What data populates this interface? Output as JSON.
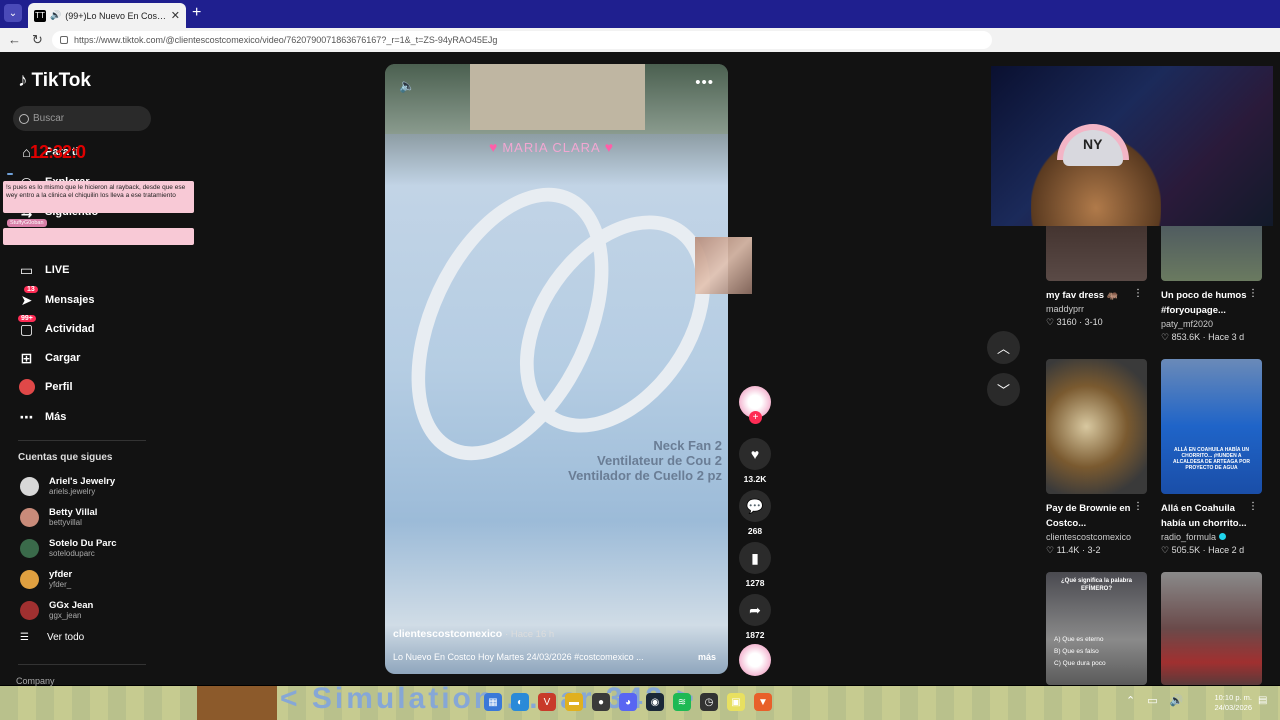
{
  "browser": {
    "tab_title": "(99+)Lo Nuevo En Costco Hoy Martes",
    "tab_favicon": "TT",
    "new_tab": "+",
    "url": "https://www.tiktok.com/@clientescostcomexico/video/7620790071863676167?_r=1&_t=ZS-94yRAO45EJg"
  },
  "sidebar": {
    "logo": "TikTok",
    "search_placeholder": "Buscar",
    "timer_text": "12:32:0",
    "menu": [
      {
        "label": "Para ti",
        "icon": "home-icon"
      },
      {
        "label": "Explorar",
        "icon": "compass-icon"
      },
      {
        "label": "Siguiendo",
        "icon": "following-icon"
      },
      {
        "label": "LIVE",
        "icon": "live-icon"
      },
      {
        "label": "Mensajes",
        "icon": "messages-icon",
        "badge": "13"
      },
      {
        "label": "Actividad",
        "icon": "activity-icon",
        "badge": "99+"
      },
      {
        "label": "Cargar",
        "icon": "upload-icon"
      },
      {
        "label": "Perfil",
        "icon": "profile-icon"
      },
      {
        "label": "Más",
        "icon": "more-icon"
      }
    ],
    "following_title": "Cuentas que sigues",
    "accounts": [
      {
        "name": "Ariel's Jewelry",
        "handle": "ariels.jewelry",
        "color": "#d8d8d8"
      },
      {
        "name": "Betty Villal",
        "handle": "bettyvillal",
        "color": "#c98b7a"
      },
      {
        "name": "Sotelo Du Parc",
        "handle": "soteloduparc",
        "color": "#3a6a4a"
      },
      {
        "name": "yfder",
        "handle": "yfder_",
        "color": "#e0a040"
      },
      {
        "name": "GGx Jean",
        "handle": "ggx_jean",
        "color": "#a03030"
      }
    ],
    "see_all": "Ver todo",
    "company": "Company"
  },
  "chat": {
    "user1": "",
    "message1": "!s pues es lo mismo que le hicieron al rayback, desde que ese wey entro a la clinica el chiquilin los lleva a ese tratamiento",
    "user2": "StuffyG0oban"
  },
  "video": {
    "overlay_title": "MARIA CLARA",
    "product_text": [
      "Neck Fan 2",
      "Ventilateur de Cou 2",
      "Ventilador de Cuello 2 pz"
    ],
    "author": "clientescostcomexico",
    "posted": "· Hace 16 h",
    "description": "Lo Nuevo En Costco Hoy Martes 24/03/2026 #costcomexico ...",
    "more": "más"
  },
  "actions": {
    "likes": "13.2K",
    "comments": "268",
    "saves": "1278",
    "shares": "1872"
  },
  "recommendations": [
    {
      "title": "my fav dress 🦛",
      "user": "maddyprr",
      "likes": "3160",
      "date": "3-10",
      "thumb": "#4a3a36"
    },
    {
      "title": "Un poco de humos #foryoupage...",
      "user": "paty_mf2020",
      "likes": "853.6K",
      "date": "Hace 3 d",
      "thumb": "#5a6470"
    },
    {
      "title": "Pay de Brownie en Costco...",
      "user": "clientescostcomexico",
      "likes": "11.4K",
      "date": "3-2",
      "thumb": "#6a5030"
    },
    {
      "title": "Allá en Coahuila había un chorrito...",
      "user": "radio_formula",
      "likes": "505.5K",
      "date": "Hace 2 d",
      "thumb": "#1f64c8",
      "verified": true,
      "thumb_text": "ALLÁ EN COAHUILA HABÍA UN CHORRITO... ¡HUNDEN A ALCALDESA DE ARTEAGA POR PROYECTO DE AGUA"
    },
    {
      "title": "",
      "user": "",
      "likes": "",
      "date": "",
      "thumb": "#6a6a6a",
      "thumb_text": "¿Qué significa la palabra EFÍMERO?",
      "quiz": [
        "A) Que es eterno",
        "B) Que es falso",
        "C) Que dura poco"
      ]
    },
    {
      "title": "",
      "user": "",
      "likes": "",
      "date": "",
      "thumb": "#7a5a5a"
    }
  ],
  "taskbar": {
    "banner_text": "< Simulation ...ear 342 >",
    "time": "10:10 p. m.",
    "date": "24/03/2026"
  }
}
